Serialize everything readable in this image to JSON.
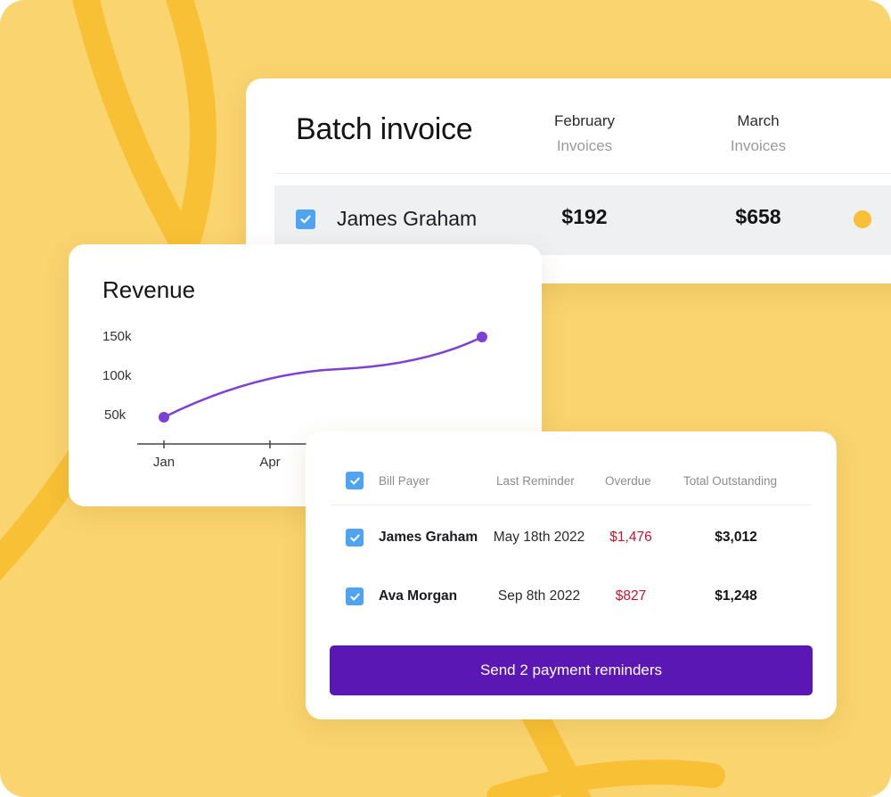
{
  "batch_invoice": {
    "title": "Batch invoice",
    "columns": [
      {
        "month": "February",
        "sub": "Invoices"
      },
      {
        "month": "March",
        "sub": "Invoices"
      }
    ],
    "row": {
      "name": "James Graham",
      "february": "$192",
      "march": "$658",
      "status_color": "#f8c034",
      "checked": true
    }
  },
  "revenue": {
    "title": "Revenue"
  },
  "chart_data": {
    "type": "line",
    "title": "Revenue",
    "x_ticks": [
      "Jan",
      "Apr"
    ],
    "y_ticks": [
      "50k",
      "100k",
      "150k"
    ],
    "ylim": [
      50000,
      150000
    ],
    "grid": false,
    "series": [
      {
        "color": "#7d40d6",
        "points": [
          {
            "x": "Jan",
            "y": 50000
          },
          {
            "x": "Oct",
            "y": 150000
          }
        ]
      }
    ]
  },
  "reminders": {
    "headers": {
      "bill_payer": "Bill Payer",
      "last_reminder": "Last Reminder",
      "overdue": "Overdue",
      "total": "Total Outstanding"
    },
    "rows": [
      {
        "name": "James Graham",
        "last_reminder": "May 18th 2022",
        "overdue": "$1,476",
        "total": "$3,012",
        "checked": true
      },
      {
        "name": "Ava Morgan",
        "last_reminder": "Sep 8th 2022",
        "overdue": "$827",
        "total": "$1,248",
        "checked": true
      }
    ],
    "send_button": "Send 2 payment reminders"
  },
  "colors": {
    "background": "#fad46e",
    "swirl": "#f8c034",
    "accent_purple": "#5a17b3",
    "line_purple": "#7d40d6",
    "checkbox_blue": "#4ea4f0",
    "overdue_red": "#c0152f"
  }
}
